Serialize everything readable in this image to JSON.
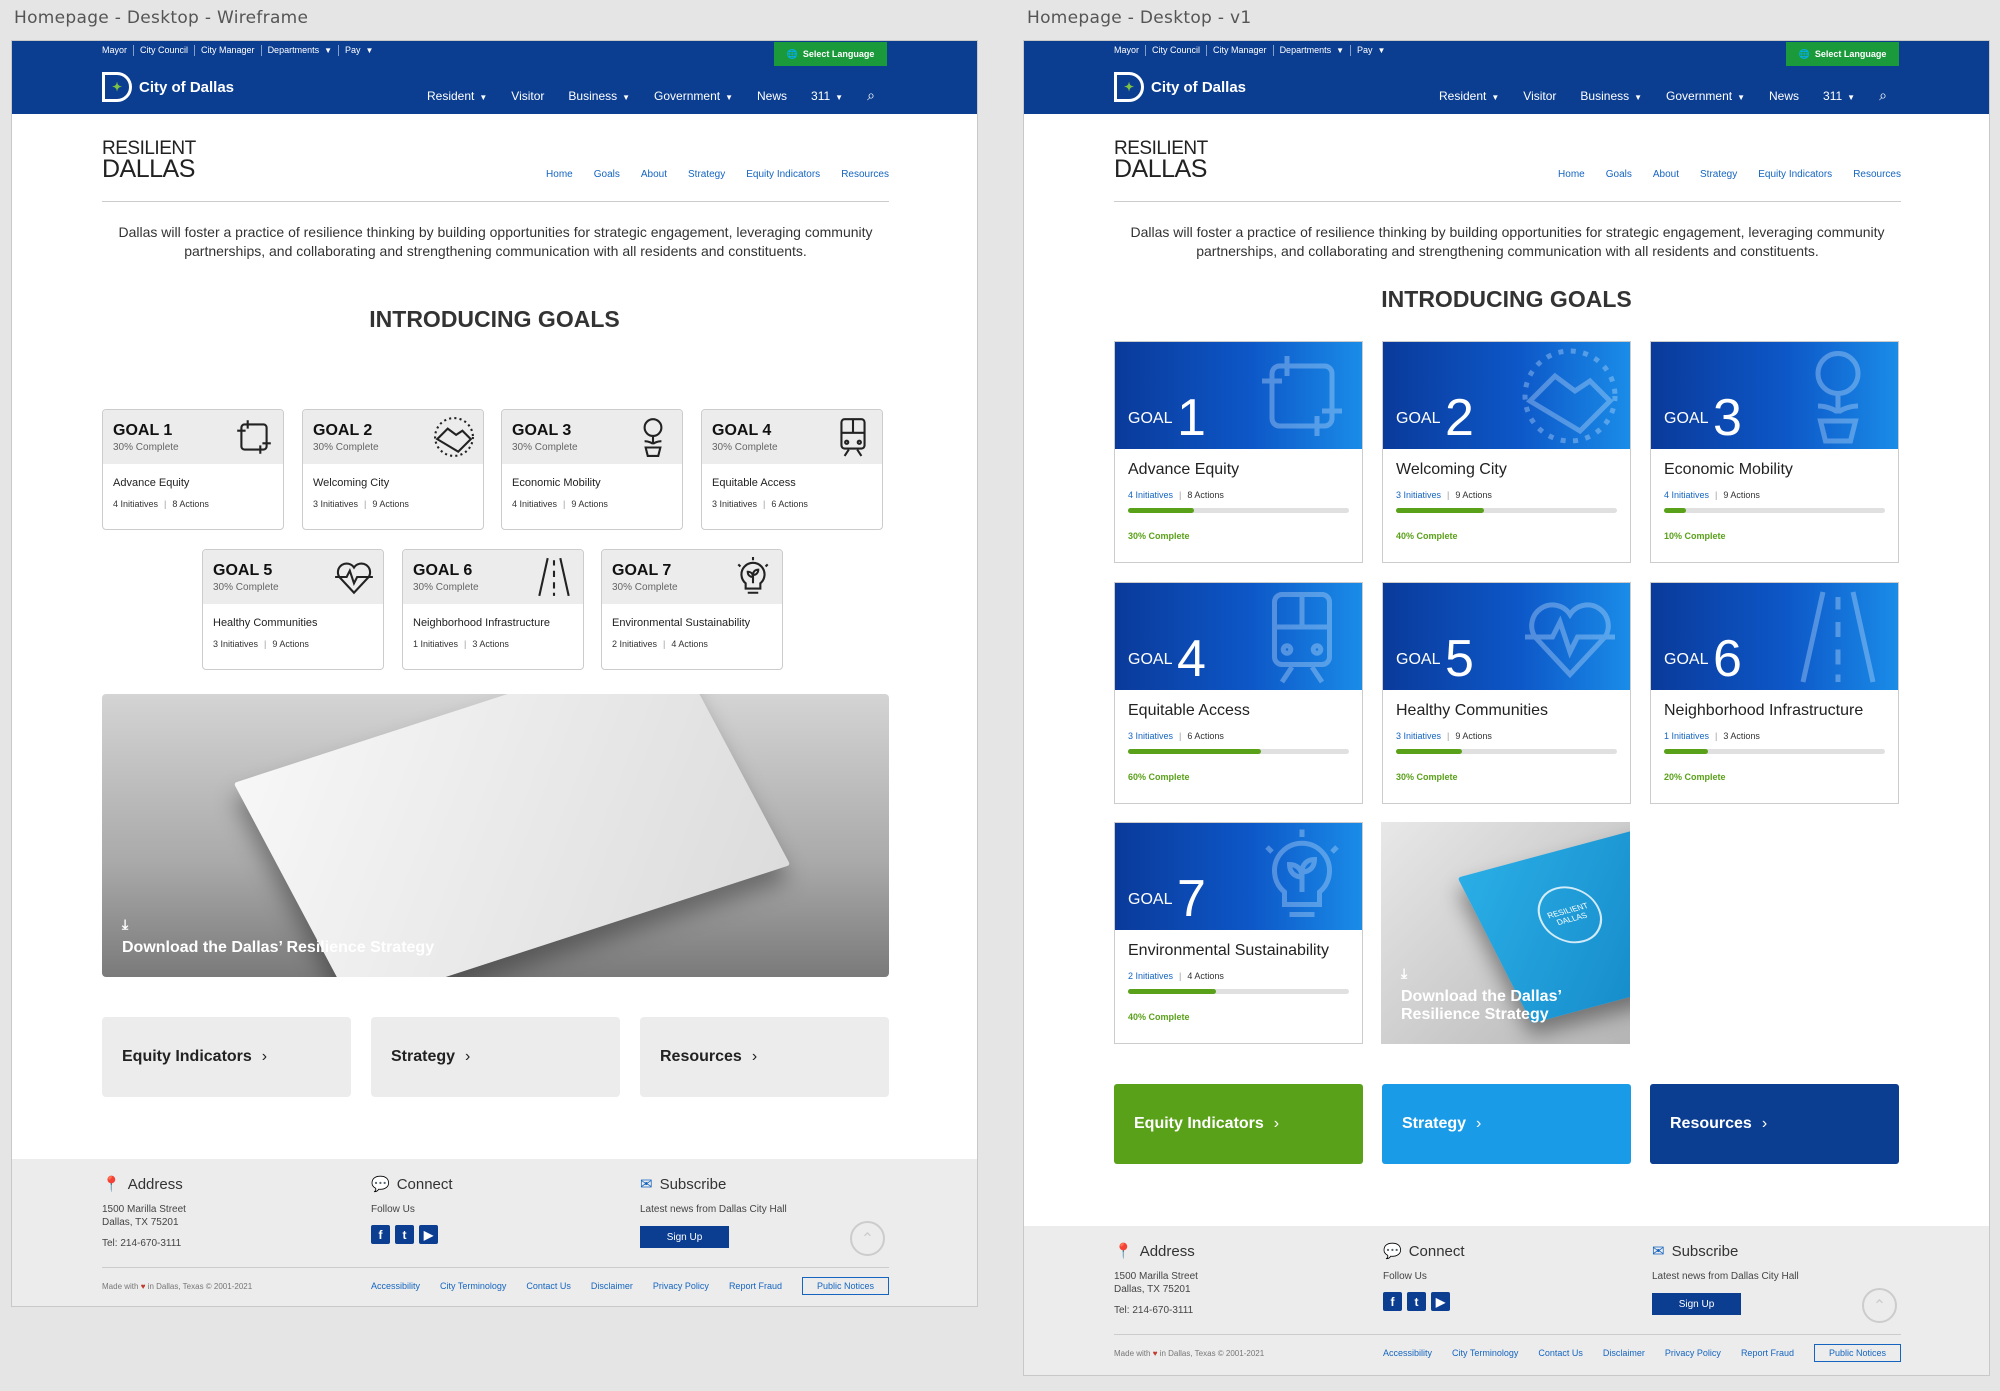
{
  "frames": {
    "wireframe_label": "Homepage - Desktop - Wireframe",
    "v1_label": "Homepage - Desktop - v1"
  },
  "header": {
    "utility": [
      "Mayor",
      "City Council",
      "City Manager",
      "Departments",
      "Pay"
    ],
    "select_language": "Select Language",
    "logo_text": "City of Dallas",
    "nav": [
      "Resident",
      "Visitor",
      "Business",
      "Government",
      "News",
      "311"
    ]
  },
  "subheader": {
    "logo_line1": "RESILIENT",
    "logo_line2": "DALLAS",
    "nav": [
      "Home",
      "Goals",
      "About",
      "Strategy",
      "Equity Indicators",
      "Resources"
    ]
  },
  "intro_text": "Dallas will foster a practice of resilience thinking by building opportunities for strategic engagement, leveraging community partnerships, and collaborating and strengthening communication with all residents and constituents.",
  "goals_heading": "INTRODUCING GOALS",
  "wireframe_goals": [
    {
      "title": "GOAL 1",
      "status": "30% Complete",
      "name": "Advance Equity",
      "initiatives": "4 Initiatives",
      "actions": "8 Actions",
      "icon": "hands-square-icon"
    },
    {
      "title": "GOAL 2",
      "status": "30% Complete",
      "name": "Welcoming City",
      "initiatives": "3 Initiatives",
      "actions": "9 Actions",
      "icon": "handshake-icon"
    },
    {
      "title": "GOAL 3",
      "status": "30% Complete",
      "name": "Economic Mobility",
      "initiatives": "4 Initiatives",
      "actions": "9 Actions",
      "icon": "money-plant-icon"
    },
    {
      "title": "GOAL 4",
      "status": "30% Complete",
      "name": "Equitable Access",
      "initiatives": "3 Initiatives",
      "actions": "6 Actions",
      "icon": "train-icon"
    },
    {
      "title": "GOAL 5",
      "status": "30% Complete",
      "name": "Healthy Communities",
      "initiatives": "3 Initiatives",
      "actions": "9 Actions",
      "icon": "heartbeat-icon"
    },
    {
      "title": "GOAL 6",
      "status": "30% Complete",
      "name": "Neighborhood Infrastructure",
      "initiatives": "1 Initiatives",
      "actions": "3 Actions",
      "icon": "road-icon"
    },
    {
      "title": "GOAL 7",
      "status": "30% Complete",
      "name": "Environmental Sustainability",
      "initiatives": "2 Initiatives",
      "actions": "4 Actions",
      "icon": "lightbulb-leaf-icon"
    }
  ],
  "v1_goals": [
    {
      "label": "GOAL",
      "num": "1",
      "name": "Advance Equity",
      "initiatives": "4 Initiatives",
      "actions": "8 Actions",
      "progress": 0.3,
      "pct_text": "30% Complete"
    },
    {
      "label": "GOAL",
      "num": "2",
      "name": "Welcoming City",
      "initiatives": "3 Initiatives",
      "actions": "9 Actions",
      "progress": 0.4,
      "pct_text": "40% Complete"
    },
    {
      "label": "GOAL",
      "num": "3",
      "name": "Economic Mobility",
      "initiatives": "4 Initiatives",
      "actions": "9 Actions",
      "progress": 0.1,
      "pct_text": "10% Complete"
    },
    {
      "label": "GOAL",
      "num": "4",
      "name": "Equitable Access",
      "initiatives": "3 Initiatives",
      "actions": "6 Actions",
      "progress": 0.6,
      "pct_text": "60% Complete"
    },
    {
      "label": "GOAL",
      "num": "5",
      "name": "Healthy Communities",
      "initiatives": "3 Initiatives",
      "actions": "9 Actions",
      "progress": 0.3,
      "pct_text": "30% Complete"
    },
    {
      "label": "GOAL",
      "num": "6",
      "name": "Neighborhood Infrastructure",
      "initiatives": "1 Initiatives",
      "actions": "3 Actions",
      "progress": 0.2,
      "pct_text": "20% Complete"
    },
    {
      "label": "GOAL",
      "num": "7",
      "name": "Environmental Sustainability",
      "initiatives": "2 Initiatives",
      "actions": "4 Actions",
      "progress": 0.4,
      "pct_text": "40% Complete"
    }
  ],
  "download_text": "Download the Dallas’ Resilience Strategy",
  "book_seal": "RESILIENT DALLAS",
  "cta_buttons": [
    "Equity Indicators",
    "Strategy",
    "Resources"
  ],
  "cta_colors": [
    "#5aa11a",
    "#1a9be8",
    "#0b3d91"
  ],
  "footer": {
    "address_title": "Address",
    "address_line1": "1500 Marilla Street",
    "address_line2": "Dallas, TX 75201",
    "tel": "Tel: 214-670-3111",
    "connect_title": "Connect",
    "follow": "Follow Us",
    "subscribe_title": "Subscribe",
    "subscribe_text": "Latest news from Dallas City Hall",
    "signup": "Sign Up",
    "made_with": "Made with",
    "made_suffix": "in Dallas, Texas © 2001-2021",
    "links": [
      "Accessibility",
      "City Terminology",
      "Contact Us",
      "Disclaimer",
      "Privacy Policy",
      "Report Fraud"
    ],
    "public_notices": "Public Notices"
  },
  "colors": {
    "brand_blue": "#0b3d91",
    "accent_green": "#5aa11a",
    "language_green": "#1a9a3a",
    "link_blue": "#1565c0"
  }
}
